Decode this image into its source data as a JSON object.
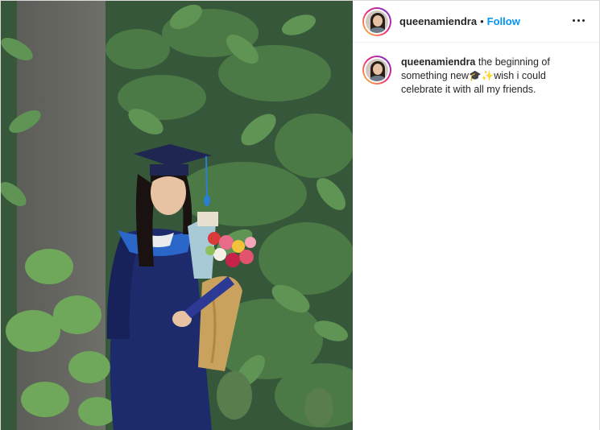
{
  "post": {
    "username": "queenamiendra",
    "separator": "•",
    "follow_label": "Follow",
    "caption": {
      "username": "queenamiendra",
      "text": "the beginning of something new🎓✨wish i could celebrate it with all my friends."
    }
  },
  "colors": {
    "follow": "#0095f6",
    "gown": "#1d2a6b",
    "foliage": "#3d6b3a"
  },
  "icons": {
    "more": "more-horizontal-icon"
  }
}
